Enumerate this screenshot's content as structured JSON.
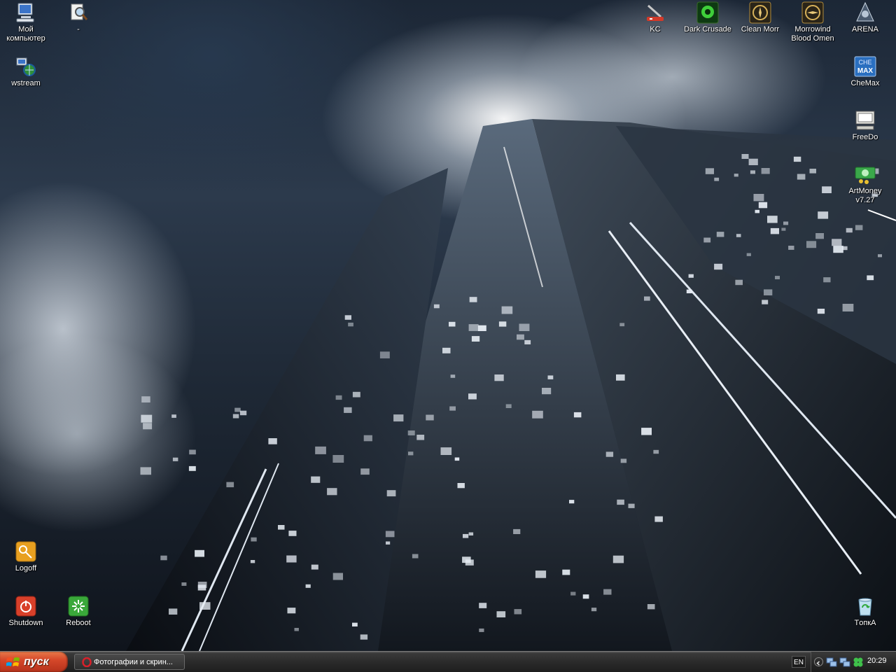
{
  "desktop": {
    "icons": {
      "my_computer": "Мой компьютер",
      "search": "-",
      "wstream": "wstream",
      "kc": "KC",
      "dark_crusade": "Dark Crusade",
      "clean_morr": "Clean Morr",
      "morrowind_blood_omen": "Morrowind Blood Omen",
      "arena": "ARENA",
      "chemax": "CheMax",
      "freedo": "FreeDo",
      "artmoney": "ArtMoney v7.27",
      "logoff": "Logoff",
      "shutdown": "Shutdown",
      "reboot": "Reboot",
      "recycle_bin": "TопкA"
    },
    "icon_names": {
      "my_computer": "computer-icon",
      "search": "search-icon",
      "wstream": "network-globe-icon",
      "kc": "tool-icon",
      "dark_crusade": "game-icon",
      "clean_morr": "game-icon",
      "morrowind_blood_omen": "game-icon",
      "arena": "game-icon",
      "chemax": "chemax-icon",
      "freedo": "monitor-icon",
      "artmoney": "money-icon",
      "logoff": "key-icon",
      "shutdown": "power-icon",
      "reboot": "reboot-icon",
      "recycle_bin": "recycle-bin-icon"
    }
  },
  "taskbar": {
    "start_label": "пуск",
    "task_label": "Фотографии и скрин...",
    "language": "EN",
    "clock": "20:29"
  },
  "colors": {
    "start_button": "#d6482a",
    "taskbar": "#2b2b2b",
    "sky_dark": "#1c2736",
    "cloud_light": "#e6eef6"
  }
}
